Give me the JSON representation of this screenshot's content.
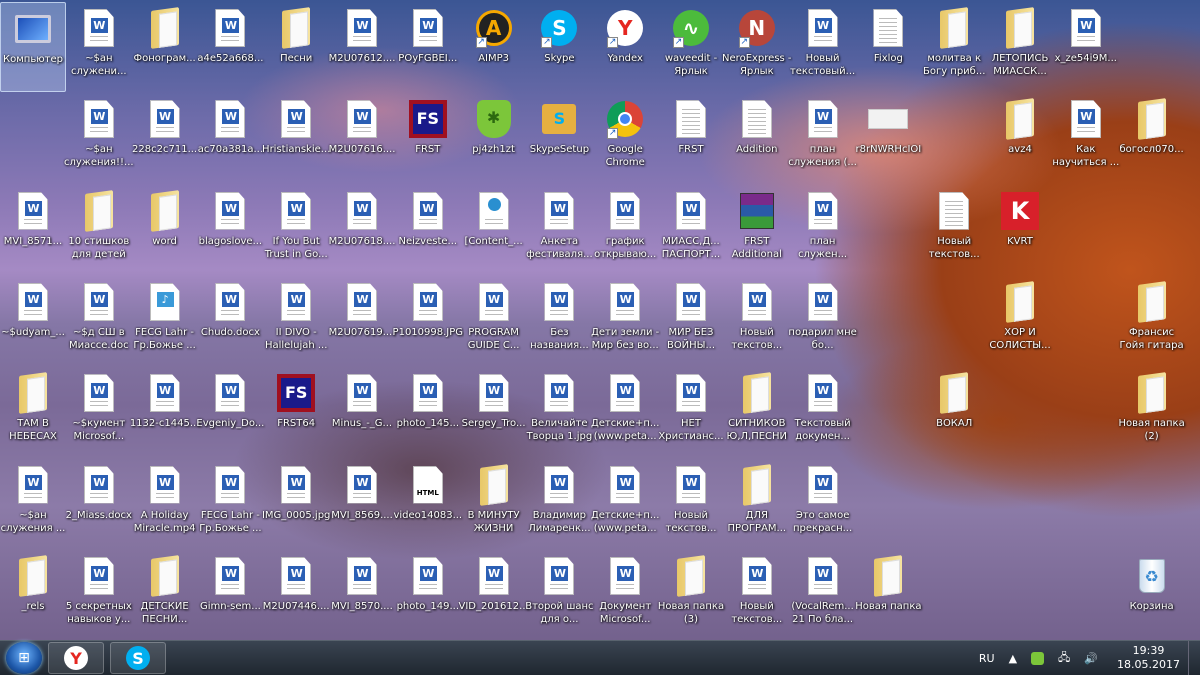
{
  "desktop": {
    "rows": [
      [
        {
          "label": "Компьютер",
          "type": "computer",
          "selected": true
        },
        {
          "label": "~$ан служени...",
          "type": "word"
        },
        {
          "label": "Фонограм...",
          "type": "folder"
        },
        {
          "label": "a4e52a668...",
          "type": "word"
        },
        {
          "label": "Песни",
          "type": "folder"
        },
        {
          "label": "M2U07612....",
          "type": "word"
        },
        {
          "label": "POyFGBEI...",
          "type": "word"
        },
        {
          "label": "AIMP3",
          "type": "aimp",
          "shortcut": true
        },
        {
          "label": "Skype",
          "type": "skype",
          "shortcut": true
        },
        {
          "label": "Yandex",
          "type": "yandex",
          "shortcut": true
        },
        {
          "label": "waveedit - Ярлык",
          "type": "waveedit",
          "shortcut": true
        },
        {
          "label": "NeroExpress - Ярлык",
          "type": "nero",
          "shortcut": true
        },
        {
          "label": "Новый текстовый...",
          "type": "word"
        },
        {
          "label": "Fixlog",
          "type": "text"
        },
        {
          "label": "молитва к Богу приб...",
          "type": "folder"
        },
        {
          "label": "ЛЕТОПИСЬ МИАССК...",
          "type": "folder"
        },
        {
          "label": "x_ze54i9M...",
          "type": "word"
        },
        null
      ],
      [
        null,
        {
          "label": "~$ан служения!!...",
          "type": "word"
        },
        {
          "label": "228c2c711...",
          "type": "word"
        },
        {
          "label": "ac70a381a...",
          "type": "word"
        },
        {
          "label": "Hristianskie...",
          "type": "word"
        },
        {
          "label": "M2U07616....",
          "type": "word"
        },
        {
          "label": "FRST",
          "type": "frst"
        },
        {
          "label": "pj4zh1zt",
          "type": "drweb"
        },
        {
          "label": "SkypeSetup",
          "type": "setup"
        },
        {
          "label": "Google Chrome",
          "type": "chrome",
          "shortcut": true
        },
        {
          "label": "FRST",
          "type": "text"
        },
        {
          "label": "Addition",
          "type": "text"
        },
        {
          "label": "план служения (...",
          "type": "word"
        },
        {
          "label": "r8rNWRHcIOI",
          "type": "image"
        },
        null,
        {
          "label": "avz4",
          "type": "folder"
        },
        {
          "label": "Как научиться ...",
          "type": "word"
        },
        {
          "label": "богосл070...",
          "type": "folder"
        }
      ],
      [
        {
          "label": "MVI_8571...",
          "type": "word"
        },
        {
          "label": "10 стишков для детей",
          "type": "folder"
        },
        {
          "label": "word",
          "type": "folder"
        },
        {
          "label": "blagoslove...",
          "type": "word"
        },
        {
          "label": "If You But Trust in Go...",
          "type": "word"
        },
        {
          "label": "M2U07618....",
          "type": "word"
        },
        {
          "label": "Neizveste...",
          "type": "word"
        },
        {
          "label": "[Content_...",
          "type": "webdoc"
        },
        {
          "label": "Анкета фестиваля...",
          "type": "word"
        },
        {
          "label": "график открываю...",
          "type": "word"
        },
        {
          "label": "МИАСС,Д... ПАСПОРТ...",
          "type": "word"
        },
        {
          "label": "FRST Additional",
          "type": "winrar"
        },
        {
          "label": "план служен...",
          "type": "word"
        },
        null,
        {
          "label": "Новый текстов...",
          "type": "text"
        },
        {
          "label": "KVRT",
          "type": "kvrt"
        },
        null,
        null
      ],
      [
        {
          "label": "~$udyam_...",
          "type": "word"
        },
        {
          "label": "~$д СШ в Миассе.doc",
          "type": "word"
        },
        {
          "label": "FECG Lahr - Гр.Божье ...",
          "type": "media"
        },
        {
          "label": "Chudo.docx",
          "type": "word"
        },
        {
          "label": "II DIVO - Hallelujah ...",
          "type": "word"
        },
        {
          "label": "M2U07619....",
          "type": "word"
        },
        {
          "label": "P1010998.JPG",
          "type": "word"
        },
        {
          "label": "PROGRAM GUIDE C...",
          "type": "word"
        },
        {
          "label": "Без названия...",
          "type": "word"
        },
        {
          "label": "Дети земли - Мир без во...",
          "type": "word"
        },
        {
          "label": "МИР БЕЗ ВОЙНЫ...",
          "type": "word"
        },
        {
          "label": "Новый текстов...",
          "type": "word"
        },
        {
          "label": "подарил мне бо...",
          "type": "word"
        },
        null,
        null,
        {
          "label": "ХОР И СОЛИСТЫ...",
          "type": "folder"
        },
        null,
        {
          "label": "Франсис Гойя гитара",
          "type": "folder"
        }
      ],
      [
        {
          "label": "ТАМ В НЕБЕСАХ",
          "type": "folder"
        },
        {
          "label": "~$кумент Microsof...",
          "type": "word"
        },
        {
          "label": "1132-c1445...",
          "type": "word"
        },
        {
          "label": "Evgeniy_Do...",
          "type": "word"
        },
        {
          "label": "FRST64",
          "type": "frst"
        },
        {
          "label": "Minus_-_G...",
          "type": "word"
        },
        {
          "label": "photo_145...",
          "type": "word"
        },
        {
          "label": "Sergey_Tro...",
          "type": "word"
        },
        {
          "label": "Величайте Творца 1.jpg",
          "type": "word"
        },
        {
          "label": "Детские+п... (www.peta...",
          "type": "word"
        },
        {
          "label": "НЕТ Христианс...",
          "type": "word"
        },
        {
          "label": "СИТНИКОВ Ю,Л,ПЕСНИ",
          "type": "folder"
        },
        {
          "label": "Текстовый докумен...",
          "type": "word"
        },
        null,
        {
          "label": "ВОКАЛ",
          "type": "folder"
        },
        null,
        null,
        {
          "label": "Новая папка (2)",
          "type": "folder"
        }
      ],
      [
        {
          "label": "~$ан служения ...",
          "type": "word"
        },
        {
          "label": "2_Miass.docx",
          "type": "word"
        },
        {
          "label": "A Holiday Miracle.mp4",
          "type": "word"
        },
        {
          "label": "FECG Lahr - Гр.Божье ...",
          "type": "word"
        },
        {
          "label": "IMG_0005.jpg",
          "type": "word"
        },
        {
          "label": "MVI_8569....",
          "type": "word"
        },
        {
          "label": "video14083...",
          "type": "html"
        },
        {
          "label": "В МИНУТУ ЖИЗНИ",
          "type": "folder"
        },
        {
          "label": "Владимир Лимаренк...",
          "type": "word"
        },
        {
          "label": "Детские+п... (www.peta...",
          "type": "word"
        },
        {
          "label": "Новый текстов...",
          "type": "word"
        },
        {
          "label": "ДЛЯ ПРОГРАМ...",
          "type": "folder"
        },
        {
          "label": "Это самое прекрасн...",
          "type": "word"
        },
        null,
        null,
        null,
        null,
        null
      ],
      [
        {
          "label": "_rels",
          "type": "folder"
        },
        {
          "label": "5 секретных навыков у...",
          "type": "word"
        },
        {
          "label": "ДЕТСКИЕ ПЕСНИ...",
          "type": "folder"
        },
        {
          "label": "Gimn-sem...",
          "type": "word"
        },
        {
          "label": "M2U07446....",
          "type": "word"
        },
        {
          "label": "MVI_8570....",
          "type": "word"
        },
        {
          "label": "photo_149...",
          "type": "word"
        },
        {
          "label": "VID_201612...",
          "type": "word"
        },
        {
          "label": "Второй шанс для о...",
          "type": "word"
        },
        {
          "label": "Документ Microsof...",
          "type": "word"
        },
        {
          "label": "Новая папка (3)",
          "type": "folder"
        },
        {
          "label": "Новый текстов...",
          "type": "word"
        },
        {
          "label": "(VocalRem... 21 По бла...",
          "type": "word"
        },
        {
          "label": "Новая папка",
          "type": "folder"
        },
        null,
        null,
        null,
        {
          "label": "Корзина",
          "type": "recycle"
        }
      ]
    ]
  },
  "taskbar": {
    "pinned": [
      {
        "name": "yandex",
        "glyph": "Y",
        "color": "#e52620"
      },
      {
        "name": "skype",
        "glyph": "S",
        "color": "#00aff0"
      }
    ],
    "tray": {
      "language": "RU",
      "time": "19:39",
      "date": "18.05.2017"
    }
  }
}
